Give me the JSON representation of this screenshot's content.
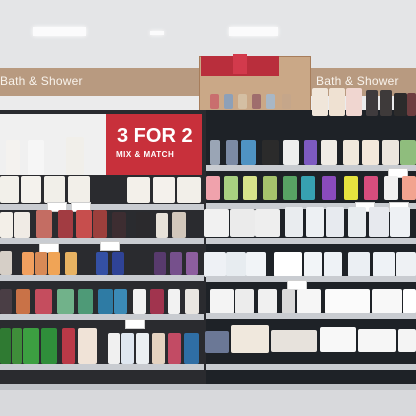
{
  "sign_left": "Bath & Shower",
  "sign_right": "Bath & Shower",
  "offer": {
    "main": "3 FOR 2",
    "sub": "MIX & MATCH"
  },
  "palette": {
    "sign_band": "#b89a80",
    "offer_red": "#c8303b",
    "shelf_edge": "#c9ccd1",
    "fixture": "#2a2b2f"
  }
}
